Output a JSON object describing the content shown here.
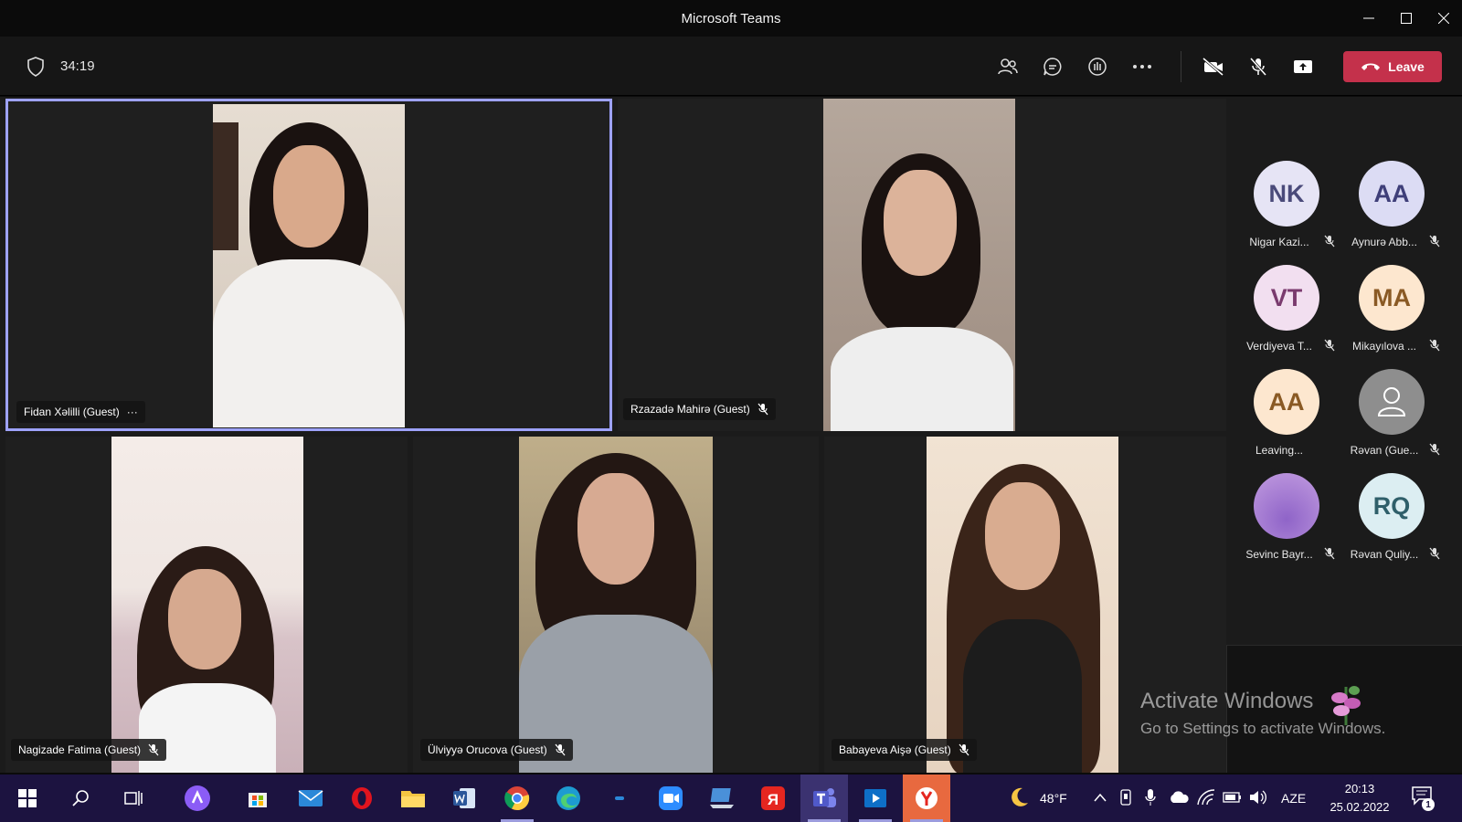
{
  "window": {
    "title": "Microsoft Teams"
  },
  "meeting": {
    "timer": "34:19",
    "leave_label": "Leave"
  },
  "colors": {
    "leave": "#c4314b",
    "active_border": "#9ea2ff",
    "taskbar": "#1c1340"
  },
  "video_tiles": [
    {
      "name": "Fidan Xəlilli (Guest)",
      "extra": "···"
    },
    {
      "name": "Rzazadə Mahirə (Guest)"
    },
    {
      "name": "Nagizade Fatima (Guest)"
    },
    {
      "name": "Ülviyyə Orucova (Guest)"
    },
    {
      "name": "Babayeva Aişə (Guest)"
    }
  ],
  "roster": [
    {
      "initials": "NK",
      "name": "Nigar Kazi...",
      "bg": "#e6e4f5",
      "fg": "#4a4a7a"
    },
    {
      "initials": "AA",
      "name": "Aynurə Abb...",
      "bg": "#dcdcf4",
      "fg": "#3f3f79"
    },
    {
      "initials": "VT",
      "name": "Verdiyeva T...",
      "bg": "#f2dff0",
      "fg": "#7a3a6e"
    },
    {
      "initials": "MA",
      "name": "Mikayılova ...",
      "bg": "#fde7cf",
      "fg": "#8a5a24"
    },
    {
      "initials": "AA",
      "name": "Leaving...",
      "bg": "#fde7cf",
      "fg": "#8a5a24"
    },
    {
      "initials": "",
      "name": "Rəvan (Gue...",
      "bg": "#8e8e8e",
      "fg": "#ffffff"
    },
    {
      "initials": "",
      "name": "Sevinc Bayr...",
      "bg": "#b27dd1",
      "fg": "#ffffff"
    },
    {
      "initials": "RQ",
      "name": "Rəvan Quliy...",
      "bg": "#dceef2",
      "fg": "#2f5f6a"
    }
  ],
  "watermark": {
    "line1": "Activate Windows",
    "line2": "Go to Settings to activate Windows."
  },
  "taskbar": {
    "weather": "48°F",
    "lang": "AZE",
    "time": "20:13",
    "date": "25.02.2022",
    "notifications": "1"
  }
}
